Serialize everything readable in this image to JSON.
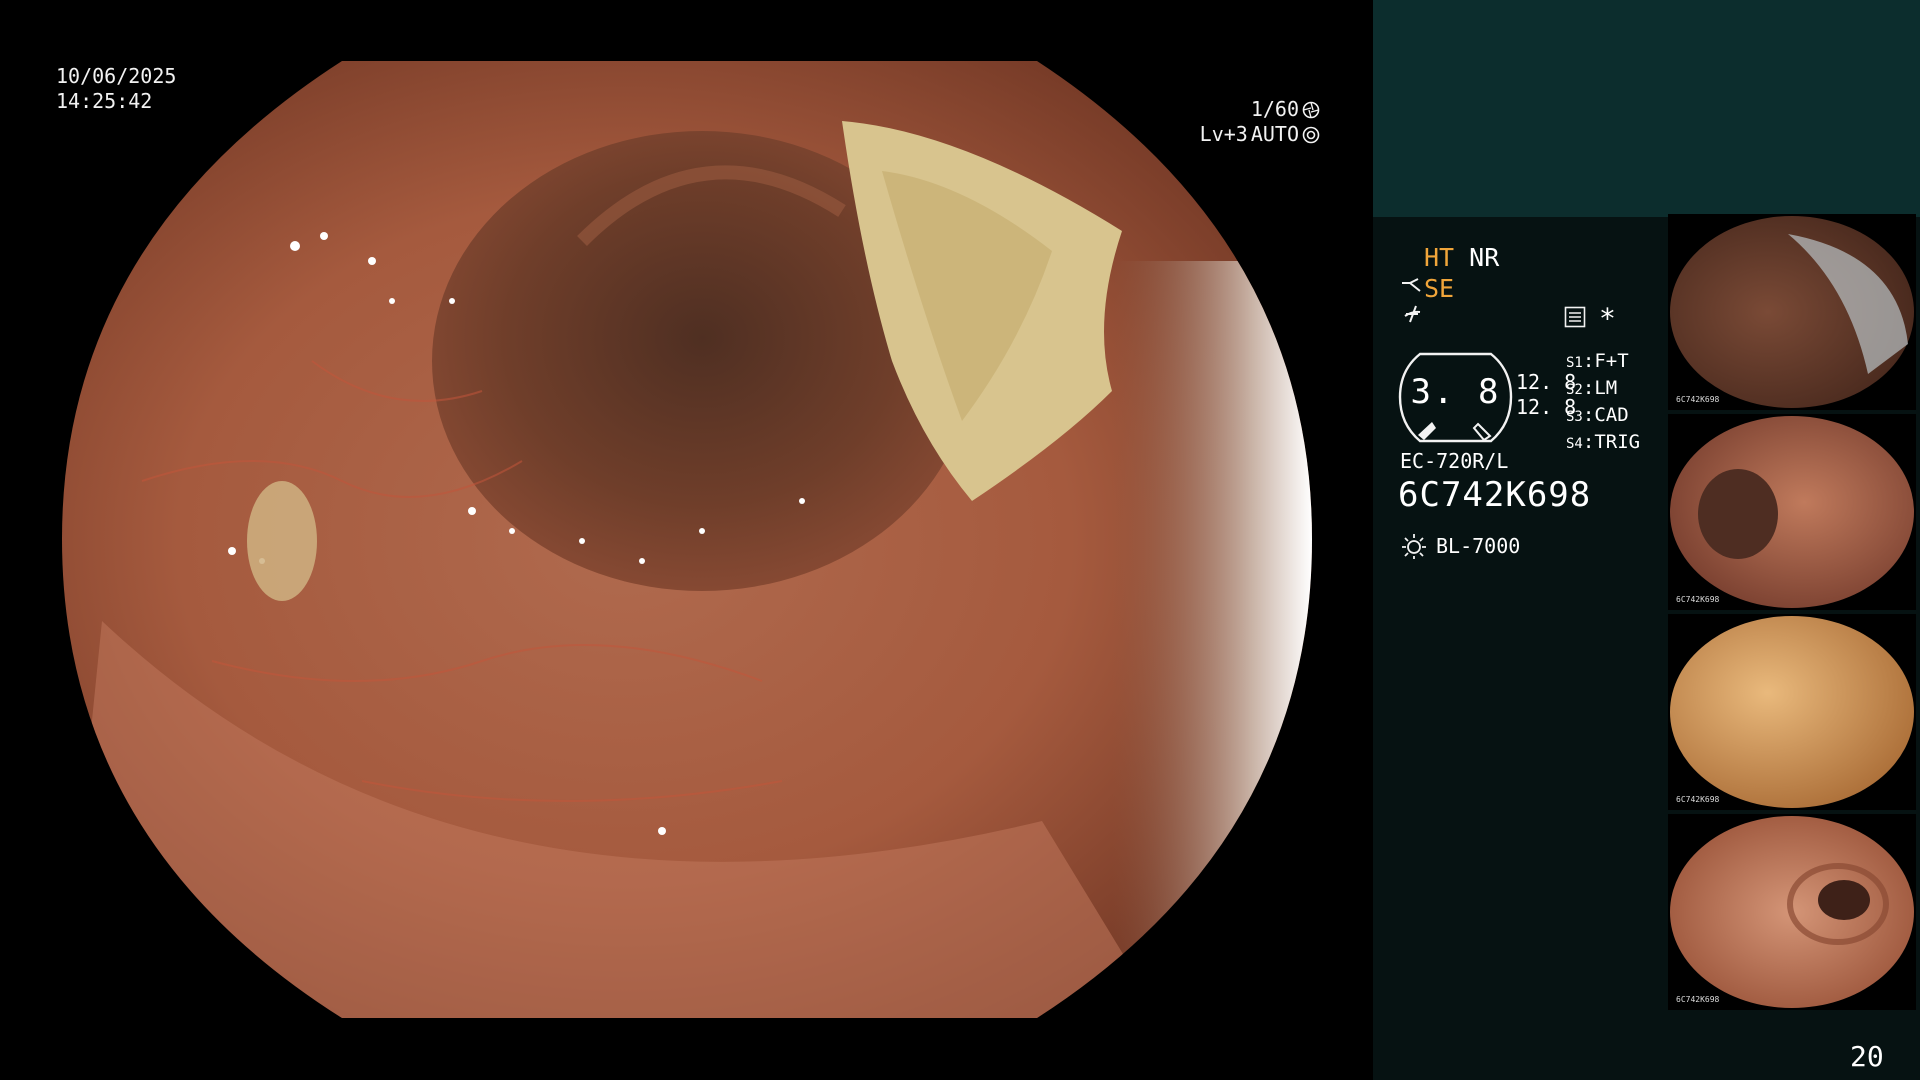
{
  "overlay": {
    "date": "10/06/2025",
    "time": "14:25:42",
    "shutter": "1/60",
    "shutter_icon": "aperture-icon",
    "iris_level": "Lv+3",
    "iris_mode": "AUTO",
    "iris_icon": "iris-icon"
  },
  "panel": {
    "ht": "HT",
    "nr": "NR",
    "se": "SE",
    "se_icon": "structure-icon",
    "enh_icon": "enhancement-icon",
    "menu_icon": "menu-icon",
    "star": "*",
    "zoom_value": "3. 8",
    "value_1": "12. 8",
    "value_2": "12. 8",
    "switches": [
      {
        "key": "S1",
        "value": "F+T"
      },
      {
        "key": "S2",
        "value": "LM"
      },
      {
        "key": "S3",
        "value": "CAD"
      },
      {
        "key": "S4",
        "value": "TRIG"
      }
    ],
    "scope_model": "EC-720R/L",
    "scope_serial": "6C742K698",
    "light_source": "BL-7000",
    "light_icon": "lamp-icon",
    "page_count": "20",
    "highlight_color": "#f0a53a"
  },
  "thumbnails": [
    {
      "label": "captured-image-1",
      "caption": "6C742K698"
    },
    {
      "label": "captured-image-2",
      "caption": "6C742K698"
    },
    {
      "label": "captured-image-3",
      "caption": "6C742K698"
    },
    {
      "label": "captured-image-4",
      "caption": "6C742K698"
    }
  ]
}
